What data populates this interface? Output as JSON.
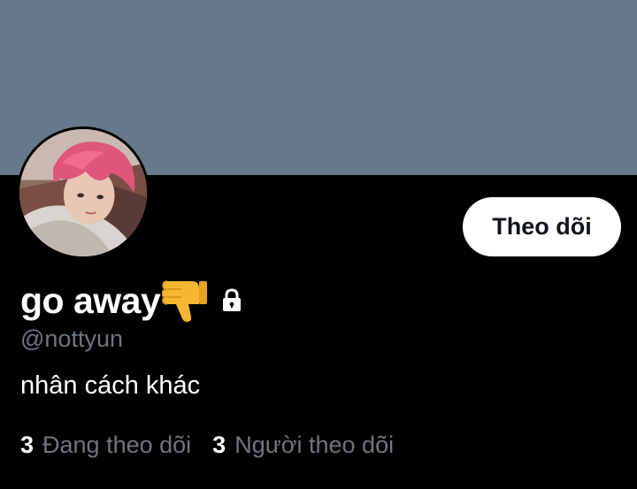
{
  "profile": {
    "display_name": "go away",
    "handle": "@nottyun",
    "bio": "nhân cách khác",
    "name_emoji": "thumbs-down-emoji",
    "protected_icon": "lock-icon",
    "avatar": "avatar-photo"
  },
  "actions": {
    "follow_label": "Theo dõi"
  },
  "stats": {
    "following_count": "3",
    "following_label": "Đang theo dõi",
    "followers_count": "3",
    "followers_label": "Người theo dõi"
  },
  "colors": {
    "banner": "#66788a",
    "background": "#000000",
    "secondary_text": "#6e767d",
    "button_bg": "#ffffff",
    "button_text": "#0f1419"
  }
}
